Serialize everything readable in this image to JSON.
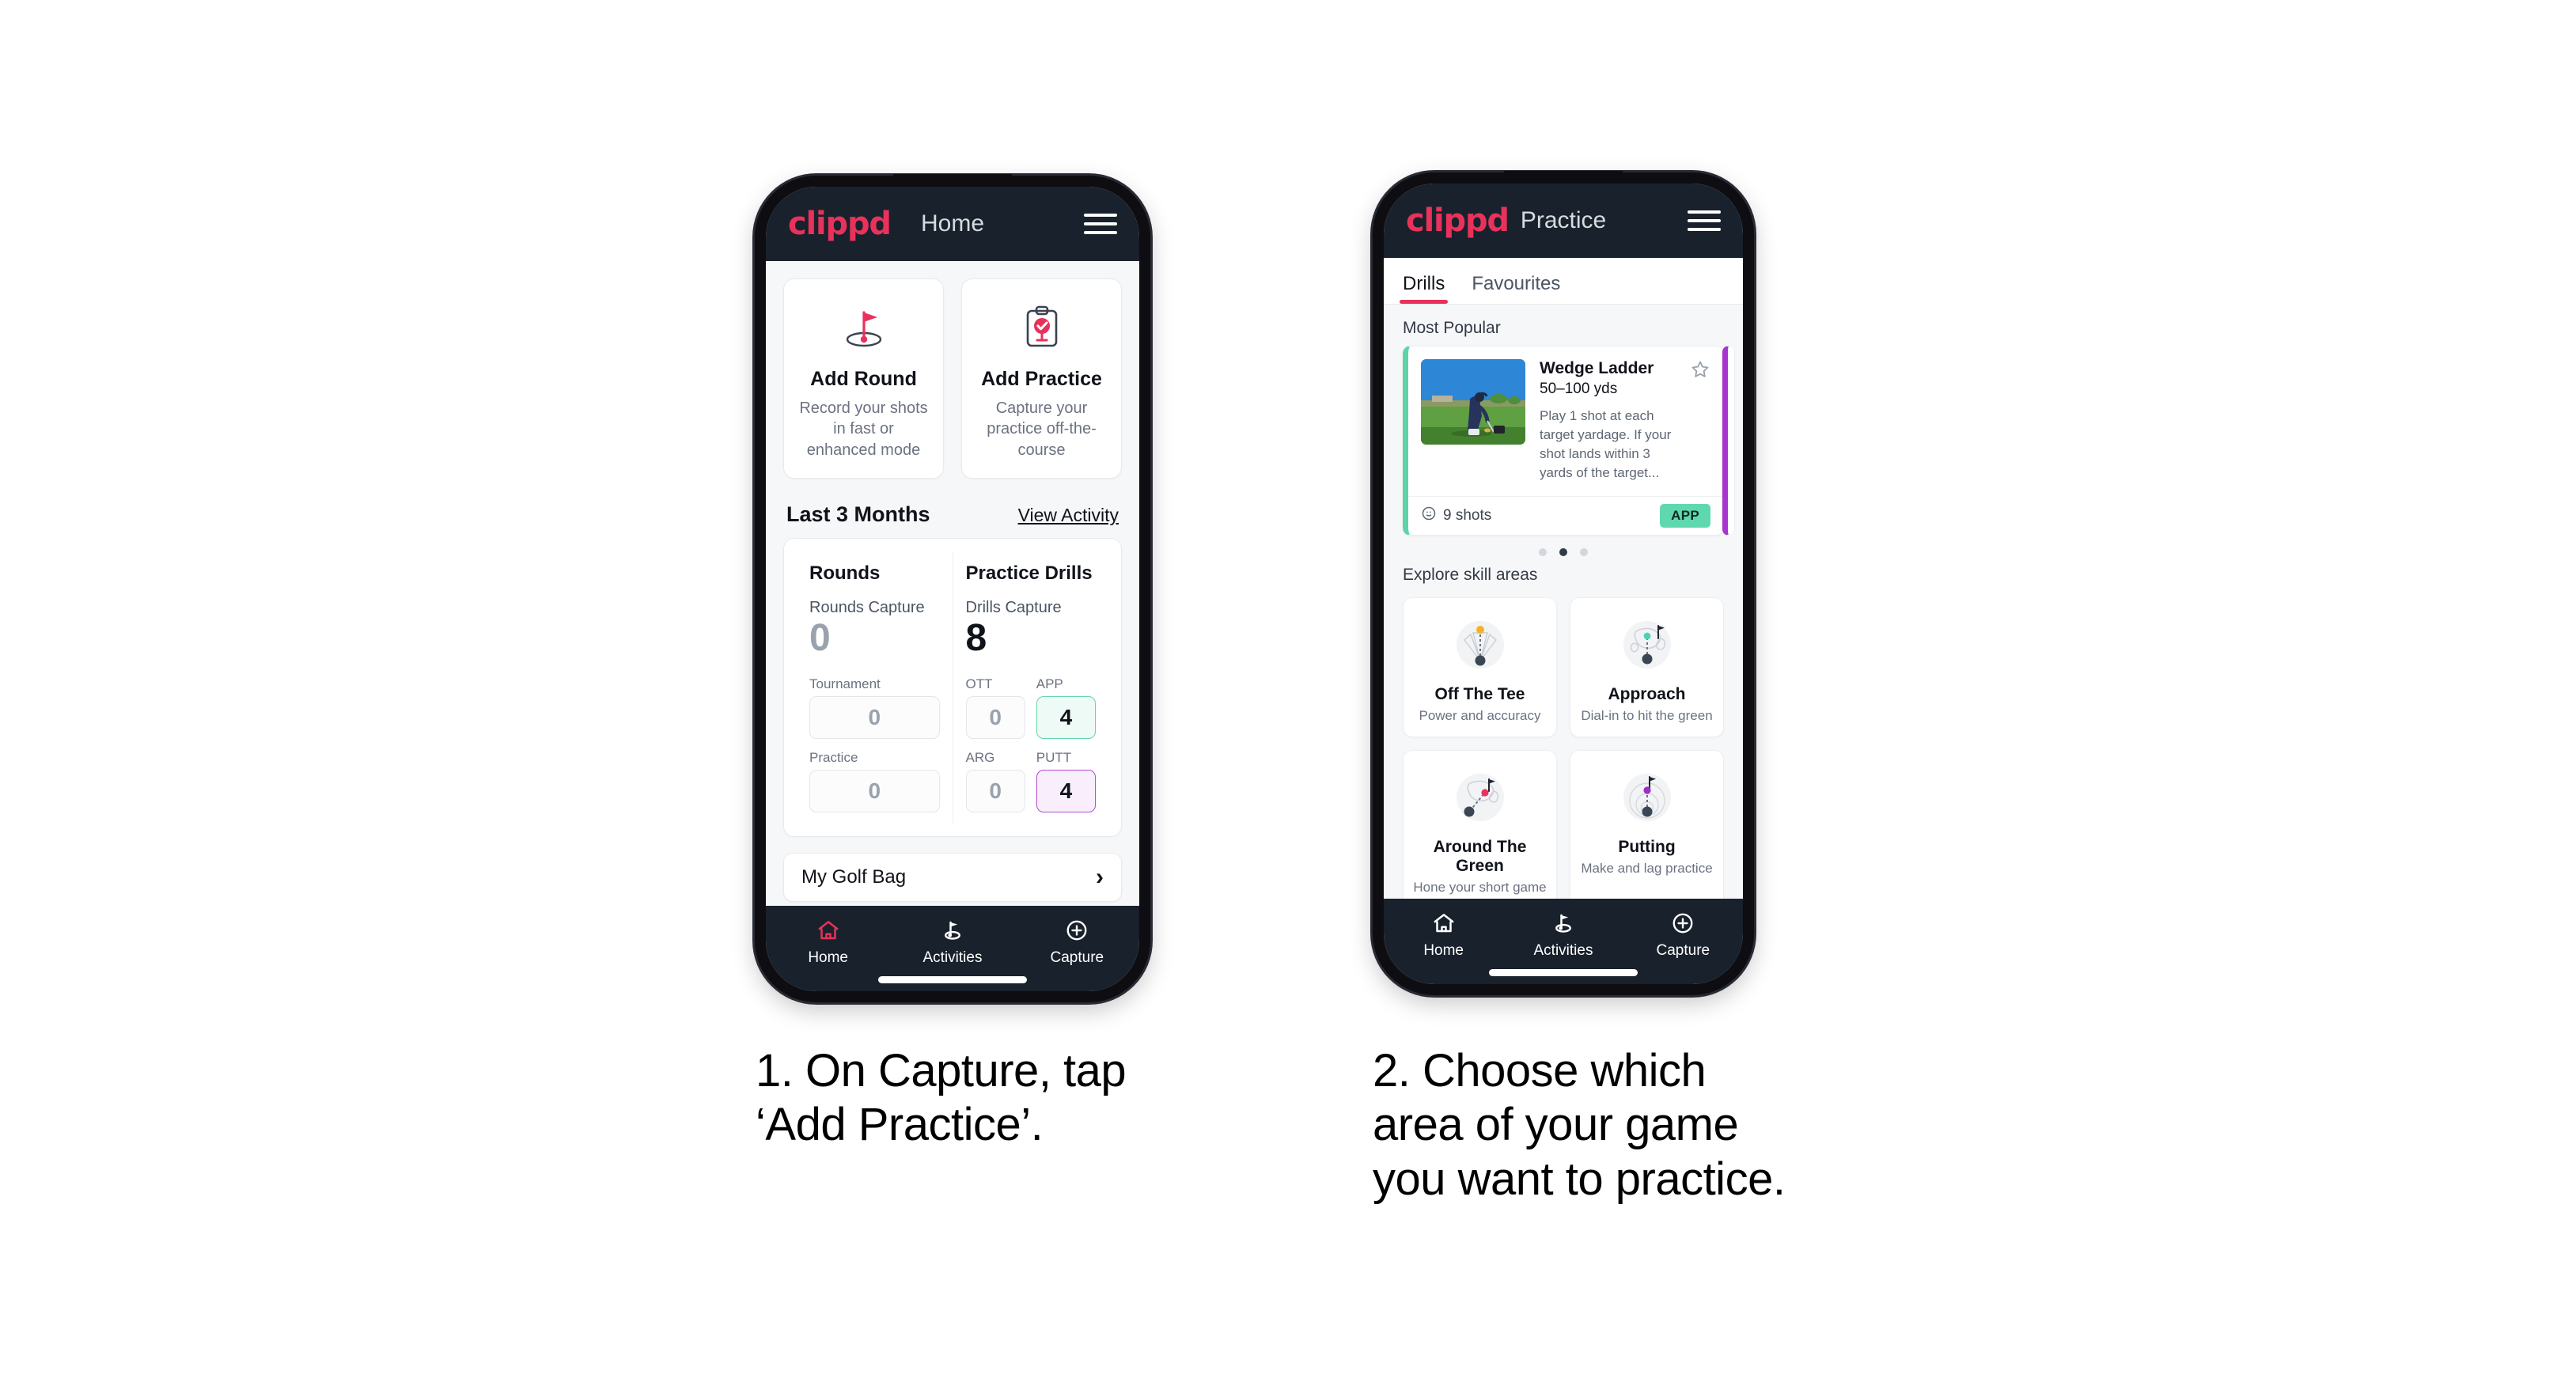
{
  "brand": {
    "logo_text": "clippd",
    "accent": "#e8325b",
    "header_bg": "#19212c"
  },
  "phone1": {
    "header": {
      "title": "Home",
      "logo": "clippd",
      "menu_icon": "hamburger-icon"
    },
    "actions": [
      {
        "icon": "golf-flag-hole-icon",
        "title": "Add Round",
        "subtitle": "Record your shots in fast or enhanced mode"
      },
      {
        "icon": "clipboard-check-tee-icon",
        "title": "Add Practice",
        "subtitle": "Capture your practice off-the-course"
      }
    ],
    "section": {
      "title": "Last 3 Months",
      "link": "View Activity"
    },
    "rounds": {
      "title": "Rounds",
      "capture_label": "Rounds Capture",
      "capture_value": "0",
      "rows": [
        {
          "label": "Tournament",
          "value": "0",
          "state": "default"
        },
        {
          "label": "Practice",
          "value": "0",
          "state": "default"
        }
      ]
    },
    "drills": {
      "title": "Practice Drills",
      "capture_label": "Drills Capture",
      "capture_value": "8",
      "cells": [
        {
          "label": "OTT",
          "value": "0",
          "state": "default"
        },
        {
          "label": "APP",
          "value": "4",
          "state": "app"
        },
        {
          "label": "ARG",
          "value": "0",
          "state": "default"
        },
        {
          "label": "PUTT",
          "value": "4",
          "state": "putt"
        }
      ]
    },
    "bag": {
      "label": "My Golf Bag",
      "chevron": "chevron-right-icon"
    },
    "nav": [
      {
        "label": "Home",
        "icon": "home-icon",
        "active": true
      },
      {
        "label": "Activities",
        "icon": "golf-flag-icon",
        "active": false
      },
      {
        "label": "Capture",
        "icon": "plus-circle-icon",
        "active": false
      }
    ]
  },
  "phone2": {
    "header": {
      "title": "Practice",
      "logo": "clippd",
      "menu_icon": "hamburger-icon"
    },
    "tabs": [
      {
        "label": "Drills",
        "active": true
      },
      {
        "label": "Favourites",
        "active": false
      }
    ],
    "most_popular_label": "Most Popular",
    "drill": {
      "title": "Wedge Ladder",
      "yardage": "50–100 yds",
      "description": "Play 1 shot at each target yardage. If your shot lands within 3 yards of the target...",
      "shots": "9 shots",
      "badge": "APP",
      "star_icon": "star-outline-icon",
      "clock_icon": "clock-icon",
      "accent": "#5ed3a8",
      "thumb": "golfer-photo"
    },
    "carousel_dots": {
      "count": 3,
      "active_index": 1
    },
    "explore_label": "Explore skill areas",
    "skills": [
      {
        "icon": "off-the-tee-icon",
        "title": "Off The Tee",
        "subtitle": "Power and accuracy",
        "dot_color": "#f3b229"
      },
      {
        "icon": "approach-icon",
        "title": "Approach",
        "subtitle": "Dial-in to hit the green",
        "dot_color": "#4fd2b4"
      },
      {
        "icon": "around-the-green-icon",
        "title": "Around The Green",
        "subtitle": "Hone your short game",
        "dot_color": "#e8325b"
      },
      {
        "icon": "putting-icon",
        "title": "Putting",
        "subtitle": "Make and lag practice",
        "dot_color": "#9b30c9"
      }
    ],
    "nav": [
      {
        "label": "Home",
        "icon": "home-icon",
        "active": false
      },
      {
        "label": "Activities",
        "icon": "golf-flag-icon",
        "active": true
      },
      {
        "label": "Capture",
        "icon": "plus-circle-icon",
        "active": false
      }
    ]
  },
  "captions": {
    "step1_line1": "1. On Capture, tap",
    "step1_line2": "‘Add Practice’.",
    "step2_line1": "2. Choose which",
    "step2_line2": "area of your game",
    "step2_line3": "you want to practice."
  }
}
